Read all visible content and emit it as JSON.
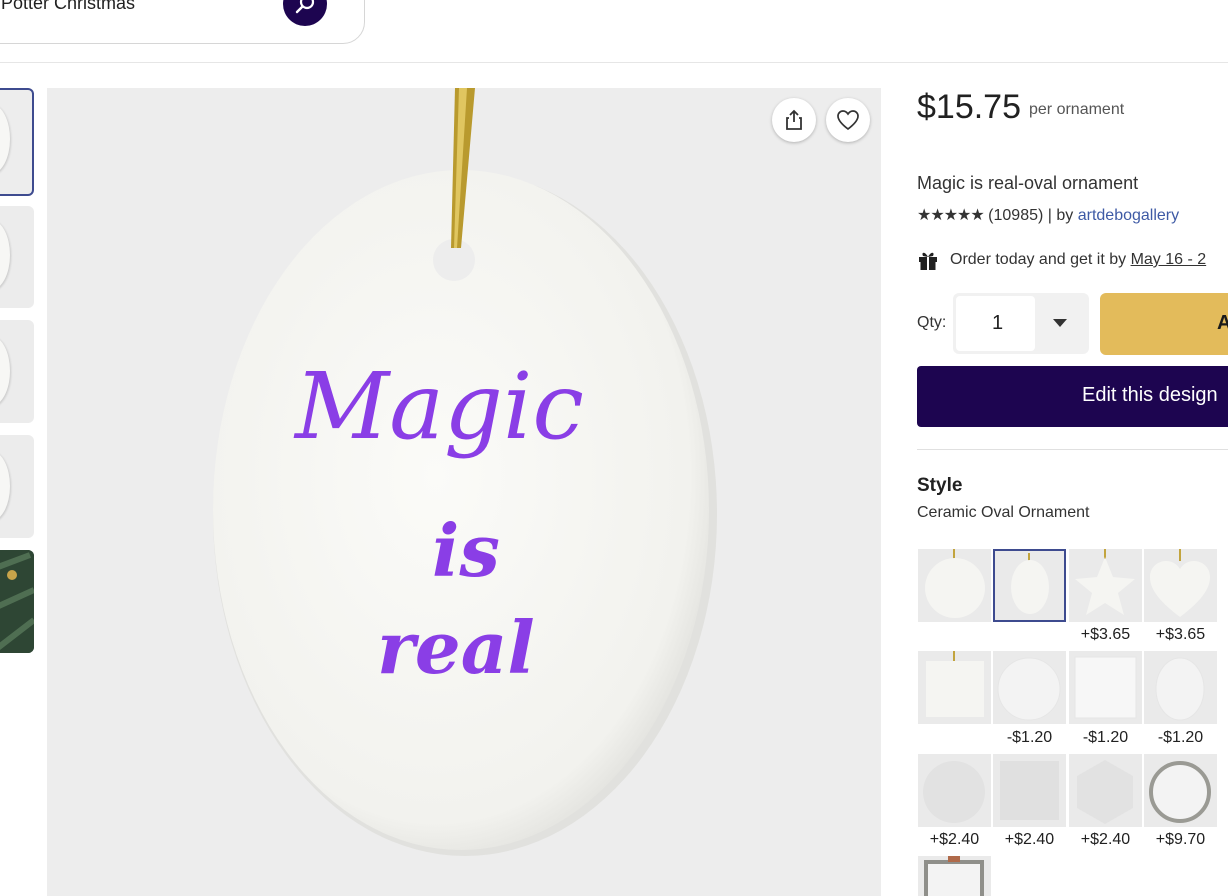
{
  "search": {
    "query": "Potter Christmas"
  },
  "product": {
    "price": "$15.75",
    "price_unit": "per ornament",
    "title": "Magic is real-oval ornament",
    "stars": "★★★★★",
    "review_count": "(10985)",
    "by_prefix": "| by",
    "seller": "artdebogallery",
    "delivery_text": "Order today and get it by",
    "delivery_date": "May 16 - 2"
  },
  "purchase": {
    "qty_label": "Qty:",
    "qty_value": "1",
    "add_label": "Add",
    "edit_label": "Edit this design"
  },
  "style": {
    "heading": "Style",
    "selected": "Ceramic Oval Ornament",
    "price_labels": [
      "+$3.65",
      "+$3.65",
      "-$1.20",
      "-$1.20",
      "-$1.20",
      "+$2.40",
      "+$2.40",
      "+$2.40",
      "+$9.70"
    ]
  },
  "ornament_text": {
    "line1": "Magic",
    "line2": "is",
    "line3": "real"
  },
  "colors": {
    "brand_dark": "#1d0550",
    "add_to_cart": "#e3bb5b",
    "ornament_text": "#8a3ee6",
    "link": "#3e5aa5"
  },
  "icons": [
    "search-icon",
    "share-icon",
    "heart-icon",
    "gift-icon",
    "chevron-down-icon"
  ]
}
